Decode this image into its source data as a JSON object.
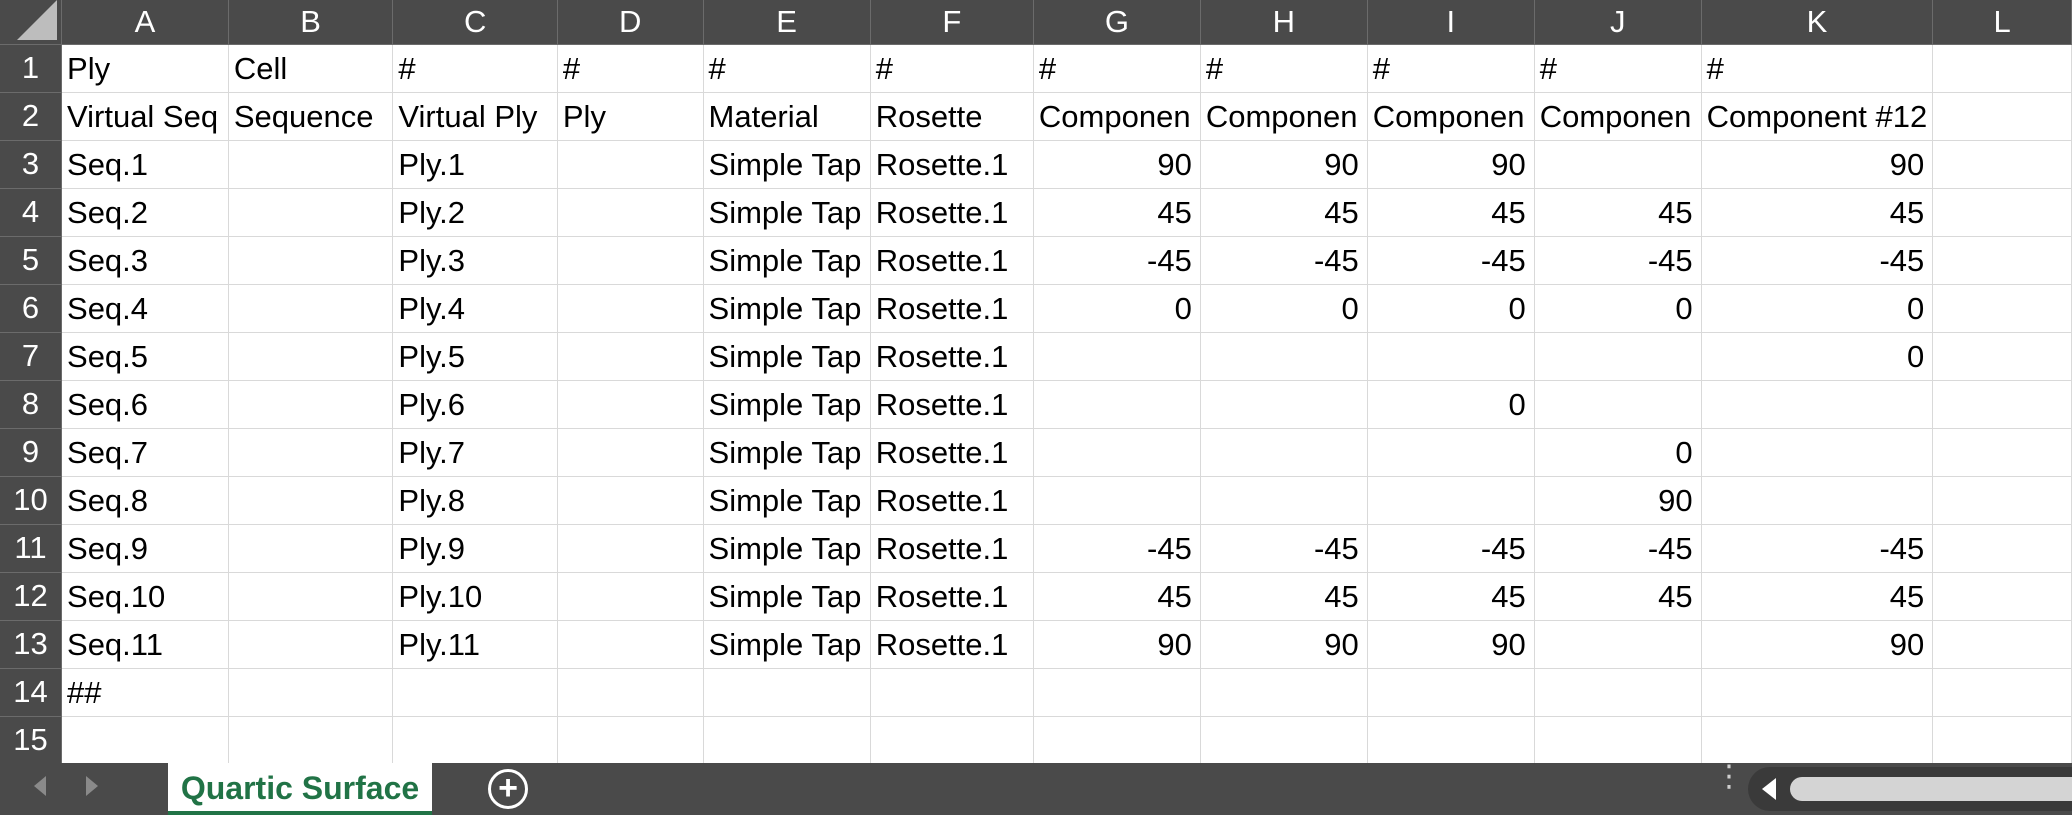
{
  "sheet": {
    "columns": [
      "A",
      "B",
      "C",
      "D",
      "E",
      "F",
      "G",
      "H",
      "I",
      "J",
      "K",
      "L"
    ],
    "rows": [
      {
        "num": "1",
        "cells": [
          "Ply",
          "Cell",
          "#",
          "#",
          "#",
          "#",
          "#",
          "#",
          "#",
          "#",
          "#",
          ""
        ]
      },
      {
        "num": "2",
        "cells": [
          "Virtual Seq",
          "Sequence",
          "Virtual Ply",
          "Ply",
          "Material",
          "Rosette",
          "Componen",
          "Componen",
          "Componen",
          "Componen",
          "Component #12",
          ""
        ]
      },
      {
        "num": "3",
        "cells": [
          "Seq.1",
          "",
          "Ply.1",
          "",
          "Simple Tap",
          "Rosette.1",
          "90",
          "90",
          "90",
          "",
          "90",
          ""
        ]
      },
      {
        "num": "4",
        "cells": [
          "Seq.2",
          "",
          "Ply.2",
          "",
          "Simple Tap",
          "Rosette.1",
          "45",
          "45",
          "45",
          "45",
          "45",
          ""
        ]
      },
      {
        "num": "5",
        "cells": [
          "Seq.3",
          "",
          "Ply.3",
          "",
          "Simple Tap",
          "Rosette.1",
          "-45",
          "-45",
          "-45",
          "-45",
          "-45",
          ""
        ]
      },
      {
        "num": "6",
        "cells": [
          "Seq.4",
          "",
          "Ply.4",
          "",
          "Simple Tap",
          "Rosette.1",
          "0",
          "0",
          "0",
          "0",
          "0",
          ""
        ]
      },
      {
        "num": "7",
        "cells": [
          "Seq.5",
          "",
          "Ply.5",
          "",
          "Simple Tap",
          "Rosette.1",
          "",
          "",
          "",
          "",
          "0",
          ""
        ]
      },
      {
        "num": "8",
        "cells": [
          "Seq.6",
          "",
          "Ply.6",
          "",
          "Simple Tap",
          "Rosette.1",
          "",
          "",
          "0",
          "",
          "",
          ""
        ]
      },
      {
        "num": "9",
        "cells": [
          "Seq.7",
          "",
          "Ply.7",
          "",
          "Simple Tap",
          "Rosette.1",
          "",
          "",
          "",
          "0",
          "",
          ""
        ]
      },
      {
        "num": "10",
        "cells": [
          "Seq.8",
          "",
          "Ply.8",
          "",
          "Simple Tap",
          "Rosette.1",
          "",
          "",
          "",
          "90",
          "",
          ""
        ]
      },
      {
        "num": "11",
        "cells": [
          "Seq.9",
          "",
          "Ply.9",
          "",
          "Simple Tap",
          "Rosette.1",
          "-45",
          "-45",
          "-45",
          "-45",
          "-45",
          ""
        ]
      },
      {
        "num": "12",
        "cells": [
          "Seq.10",
          "",
          "Ply.10",
          "",
          "Simple Tap",
          "Rosette.1",
          "45",
          "45",
          "45",
          "45",
          "45",
          ""
        ]
      },
      {
        "num": "13",
        "cells": [
          "Seq.11",
          "",
          "Ply.11",
          "",
          "Simple Tap",
          "Rosette.1",
          "90",
          "90",
          "90",
          "",
          "90",
          ""
        ]
      },
      {
        "num": "14",
        "cells": [
          "##",
          "",
          "",
          "",
          "",
          "",
          "",
          "",
          "",
          "",
          "",
          ""
        ]
      },
      {
        "num": "15",
        "cells": [
          "",
          "",
          "",
          "",
          "",
          "",
          "",
          "",
          "",
          "",
          "",
          ""
        ]
      }
    ]
  },
  "tabs": {
    "active_sheet": "Quartic Surface",
    "add_sheet_symbol": "+",
    "more_symbol": "⋮"
  },
  "colors": {
    "header_bg": "#4a4a4a",
    "active_tab_text": "#217346",
    "gridline": "#d9d9d9"
  }
}
